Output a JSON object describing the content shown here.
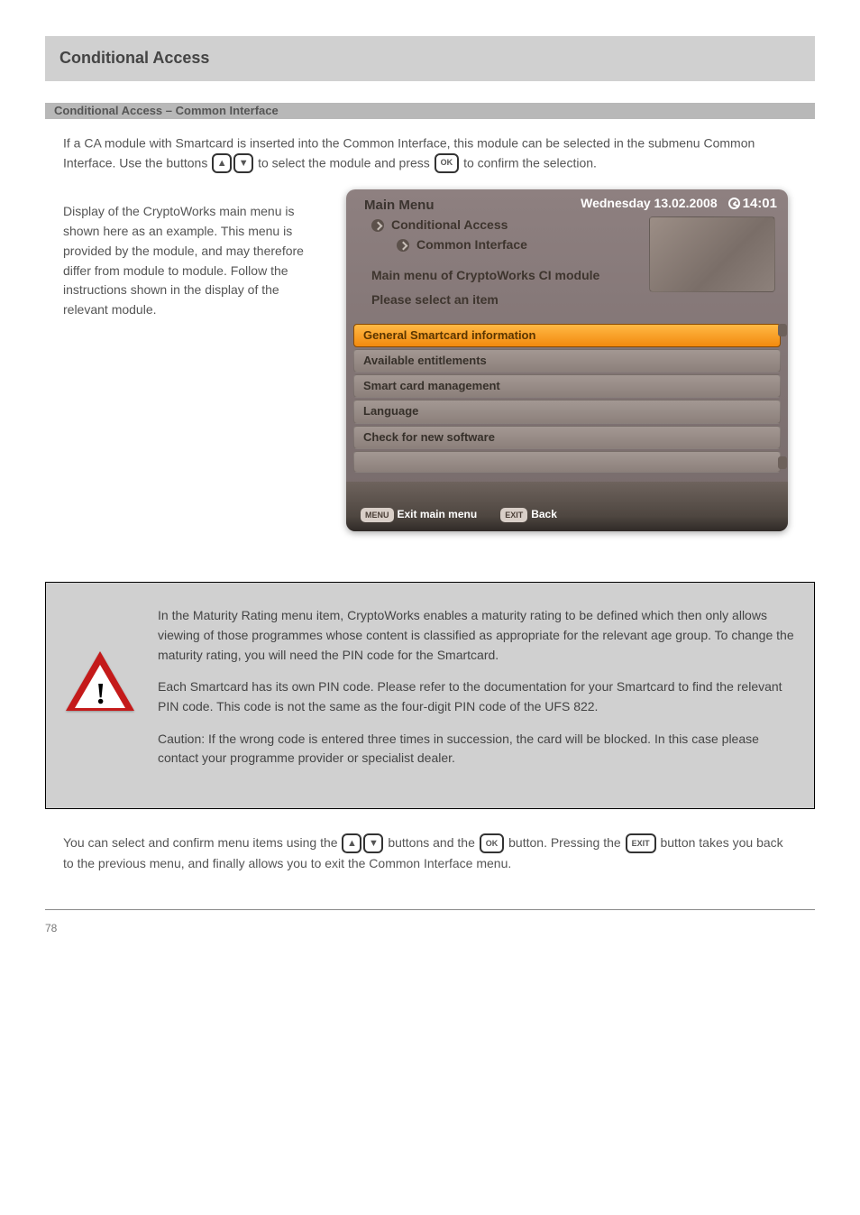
{
  "header": {
    "title": "Conditional Access",
    "sub": "Conditional Access – Common Interface"
  },
  "intro": {
    "p1_a": "If a CA module with Smartcard is inserted into the Common Interface, this module can be selected in the submenu Common Interface. Use the buttons",
    "p1_b": "to select the module and press",
    "p1_c": "to confirm the selection."
  },
  "explain": {
    "p": "Display of the CryptoWorks main menu is shown here as an example. This menu is provided by the module, and may therefore differ from module to module. Follow the instructions shown in the display of the relevant module."
  },
  "osd": {
    "title": "Main Menu",
    "date": "Wednesday 13.02.2008",
    "time": "14:01",
    "crumb1": "Conditional Access",
    "crumb2": "Common Interface",
    "heading": "Main menu of CryptoWorks CI module",
    "sub": "Please select an item",
    "items": [
      "General Smartcard information",
      "Available entitlements",
      "Smart card management",
      "Language",
      "Check for new software"
    ],
    "f1_badge": "MENU",
    "f1_text": "Exit main menu",
    "f2_badge": "EXIT",
    "f2_text": "Back"
  },
  "warn": {
    "p1": "In the Maturity Rating menu item, CryptoWorks enables a maturity rating to be defined which then only allows viewing of those programmes whose content is classified as appropriate for the relevant age group. To change the maturity rating, you will need the PIN code for the Smartcard.",
    "p2": "Each Smartcard has its own PIN code. Please refer to the documentation for your Smartcard to find the relevant PIN code. This code is not the same as the four-digit PIN code of the UFS 822.",
    "p3": "Caution: If the wrong code is entered three times in succession, the card will be blocked. In this case please contact your programme provider or specialist dealer."
  },
  "instr2": {
    "a": "You can select and confirm menu items using the",
    "b": "buttons and the",
    "c": "button. Pressing the",
    "d": "button takes you back to the previous menu, and finally allows you to exit the Common Interface menu."
  },
  "foot": {
    "page": "78"
  },
  "keys": {
    "up": "▲",
    "down": "▼",
    "ok": "OK",
    "exit": "EXIT"
  }
}
